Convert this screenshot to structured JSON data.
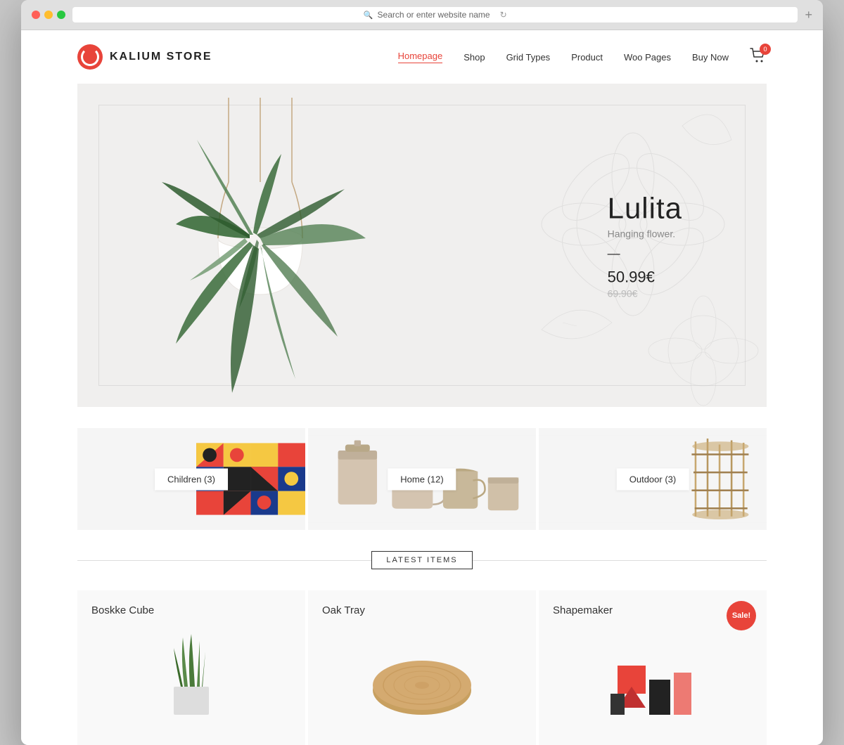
{
  "browser": {
    "address_placeholder": "Search or enter website name",
    "new_tab_label": "+"
  },
  "header": {
    "logo_text": "KALIUM STORE",
    "nav": {
      "items": [
        {
          "label": "Homepage",
          "active": true
        },
        {
          "label": "Shop",
          "active": false
        },
        {
          "label": "Grid Types",
          "active": false
        },
        {
          "label": "Product",
          "active": false
        },
        {
          "label": "Woo Pages",
          "active": false
        },
        {
          "label": "Buy Now",
          "active": false
        }
      ]
    },
    "cart_count": "0"
  },
  "hero": {
    "title": "Lulita",
    "subtitle": "Hanging flower.",
    "divider": "—",
    "price": "50.99€",
    "price_old": "69.90€"
  },
  "categories": {
    "items": [
      {
        "label": "Children",
        "count": 3
      },
      {
        "label": "Home",
        "count": 12
      },
      {
        "label": "Outdoor",
        "count": 3
      }
    ]
  },
  "latest_section": {
    "label": "LATEST ITEMS"
  },
  "products": {
    "items": [
      {
        "title": "Boskke Cube",
        "sale": false
      },
      {
        "title": "Oak Tray",
        "sale": false
      },
      {
        "title": "Shapemaker",
        "sale": true,
        "sale_label": "Sale!"
      }
    ]
  }
}
